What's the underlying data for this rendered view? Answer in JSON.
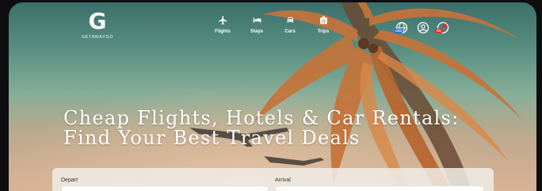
{
  "brand": {
    "logo_letter": "G",
    "name": "GETAWAYGO"
  },
  "nav": [
    {
      "label": "Flights",
      "icon": "plane-icon"
    },
    {
      "label": "Stays",
      "icon": "bed-icon"
    },
    {
      "label": "Cars",
      "icon": "car-icon"
    },
    {
      "label": "Trips",
      "icon": "suitcase-icon"
    }
  ],
  "header_icons": [
    {
      "icon": "globe-currency-icon",
      "badge": "USD"
    },
    {
      "icon": "user-account-icon"
    },
    {
      "icon": "flag-language-icon",
      "badge": "EN"
    }
  ],
  "hero": {
    "line1": "Cheap Flights, Hotels & Car Rentals:",
    "line2": "Find Your Best Travel Deals"
  },
  "search": {
    "depart_label": "Depart",
    "arrival_label": "Arrival"
  },
  "colors": {
    "accent": "#ffffff",
    "card": "#f0ece6",
    "badge_blue": "#2f6fd6",
    "badge_red": "#d8322c"
  }
}
